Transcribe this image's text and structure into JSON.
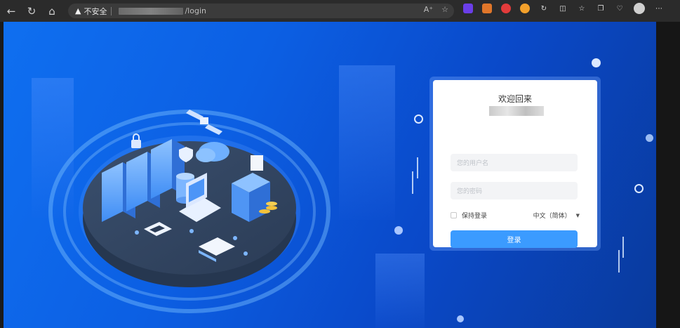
{
  "browser": {
    "security_label": "不安全",
    "url_path": "/login",
    "reader_icon": "read-aloud-icon",
    "ext_count": 4
  },
  "login": {
    "welcome": "欢迎回来",
    "username_placeholder": "您的用户名",
    "password_placeholder": "您的密码",
    "remember_label": "保持登录",
    "language": "中文（简体）",
    "submit_label": "登录"
  },
  "colors": {
    "accent": "#3b9bff",
    "background": "#0c5fe3"
  }
}
